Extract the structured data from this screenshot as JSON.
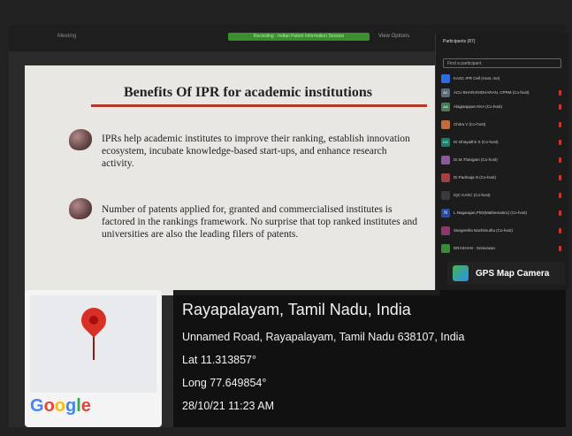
{
  "meeting": {
    "top_left": "Meeting",
    "recording_bar": "Recording · Indian Patent Information Session",
    "view_options": "View Options"
  },
  "slide": {
    "title": "Benefits Of IPR for academic institutions",
    "bullets": [
      {
        "text": "IPRs help academic institutes to improve their ranking, establish innovation ecosystem, incubate knowledge-based start-ups, and enhance research activity."
      },
      {
        "text": "Number of patents applied for, granted and commercialised institutes is factored in the rankings framework. No surprise that top ranked institutes and universities are also the leading filers of patents."
      }
    ]
  },
  "participants_panel": {
    "title": "Participants (87)",
    "search_placeholder": "Find a participant",
    "items": [
      {
        "initials": "",
        "name": "KASC IPR Cell (Host, me)",
        "color": "#2d6cdf"
      },
      {
        "initials": "AC",
        "name": "ACU BHARANIDHARAN, CPRM (Co-host)",
        "color": "#5b6b7a"
      },
      {
        "initials": "AA",
        "name": "Alagiaappan KKA (Co-host)",
        "color": "#4a7a58"
      },
      {
        "initials": "",
        "name": "Chitra V (Co-host)",
        "color": "#c26b3b"
      },
      {
        "initials": "DS",
        "name": "Dr Dhayaithri S (Co-host)",
        "color": "#1f7a6a"
      },
      {
        "initials": "",
        "name": "Dr.M.Thangam (Co-host)",
        "color": "#8a5a9a"
      },
      {
        "initials": "",
        "name": "Dr.Padmaja N (Co-host)",
        "color": "#a04040"
      },
      {
        "initials": "",
        "name": "IQC KASC (Co-host)",
        "color": "#3a3a3a"
      },
      {
        "initials": "N",
        "name": "L.Nagarajan,PhD(Mathematics) (Co-host)",
        "color": "#2a4aa0"
      },
      {
        "initials": "",
        "name": "Sangeetha Nachimuthu (Co-host)",
        "color": "#8a3a6a"
      },
      {
        "initials": "",
        "name": "DRASHAN · Srinivasan",
        "color": "#3a8a3a"
      }
    ]
  },
  "gps_camera": {
    "label": "GPS Map Camera"
  },
  "location": {
    "place": "Rayapalayam, Tamil Nadu, India",
    "address": "Unnamed Road, Rayapalayam, Tamil Nadu 638107, India",
    "lat": "Lat 11.313857°",
    "long": "Long 77.649854°",
    "datetime": "28/10/21 11:23 AM",
    "map_brand": "Google"
  },
  "colors": {
    "accent_red": "#b23a2a",
    "pin_red": "#d93025"
  }
}
